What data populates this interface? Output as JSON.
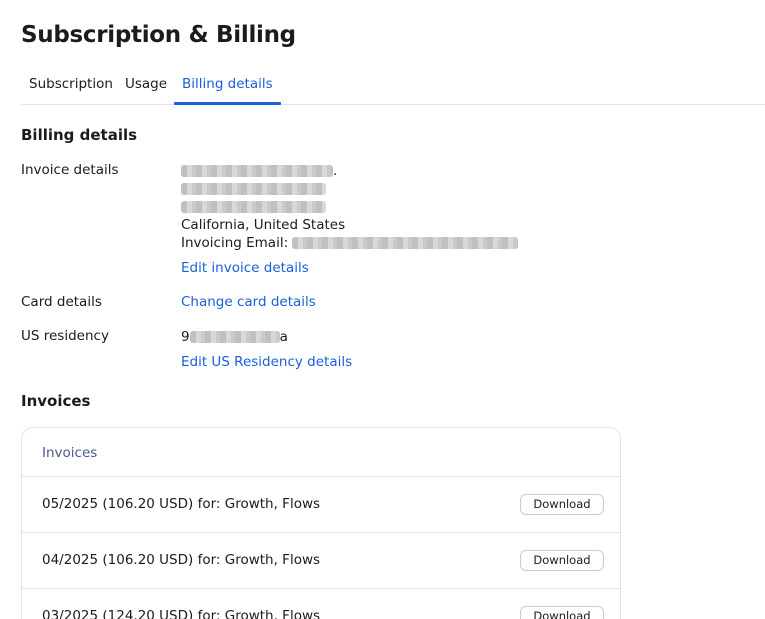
{
  "page": {
    "title": "Subscription & Billing"
  },
  "tabs": [
    {
      "label": "Subscription",
      "active": false
    },
    {
      "label": "Usage",
      "active": false
    },
    {
      "label": "Billing details",
      "active": true
    }
  ],
  "billing": {
    "title": "Billing details",
    "invoice_details": {
      "label": "Invoice details",
      "line1_suffix": ".",
      "location": "California, United States",
      "email_label": "Invoicing Email:",
      "edit_link": "Edit invoice details"
    },
    "card_details": {
      "label": "Card details",
      "link": "Change card details"
    },
    "us_residency": {
      "label": "US residency",
      "value_prefix": "9",
      "value_suffix": "a",
      "edit_link": "Edit US Residency details"
    }
  },
  "invoices": {
    "title": "Invoices",
    "table_header": "Invoices",
    "download_label": "Download",
    "rows": [
      {
        "text": "05/2025 (106.20 USD) for: Growth, Flows"
      },
      {
        "text": "04/2025 (106.20 USD) for: Growth, Flows"
      },
      {
        "text": "03/2025 (124.20 USD) for: Growth, Flows"
      }
    ]
  },
  "colors": {
    "accent": "#1a5fd9",
    "border": "#e3e4e8",
    "text": "#1b1b1f"
  }
}
